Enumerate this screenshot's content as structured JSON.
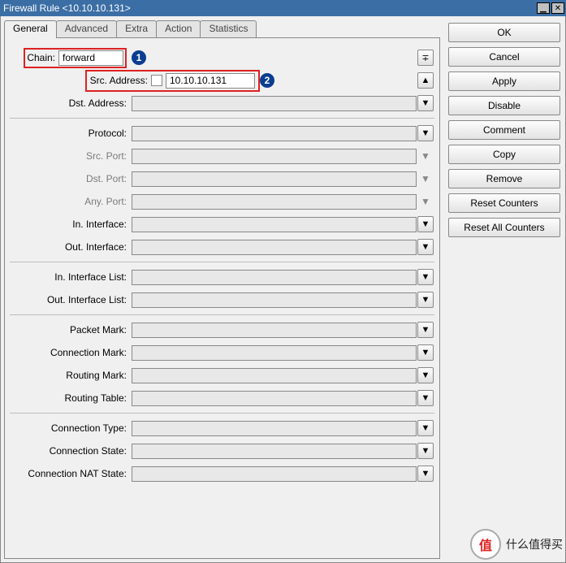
{
  "window": {
    "title": "Firewall Rule <10.10.10.131>"
  },
  "tabs": [
    "General",
    "Advanced",
    "Extra",
    "Action",
    "Statistics"
  ],
  "active_tab": "General",
  "fields": {
    "chain_label": "Chain:",
    "chain_value": "forward",
    "src_addr_label": "Src. Address:",
    "src_addr_value": "10.10.10.131",
    "dst_addr_label": "Dst. Address:",
    "protocol_label": "Protocol:",
    "src_port_label": "Src. Port:",
    "dst_port_label": "Dst. Port:",
    "any_port_label": "Any. Port:",
    "in_if_label": "In. Interface:",
    "out_if_label": "Out. Interface:",
    "in_if_list_label": "In. Interface List:",
    "out_if_list_label": "Out. Interface List:",
    "packet_mark_label": "Packet Mark:",
    "conn_mark_label": "Connection Mark:",
    "routing_mark_label": "Routing Mark:",
    "routing_table_label": "Routing Table:",
    "conn_type_label": "Connection Type:",
    "conn_state_label": "Connection State:",
    "conn_nat_state_label": "Connection NAT State:"
  },
  "annotations": {
    "badge1": "1",
    "badge2": "2"
  },
  "buttons": {
    "ok": "OK",
    "cancel": "Cancel",
    "apply": "Apply",
    "disable": "Disable",
    "comment": "Comment",
    "copy": "Copy",
    "remove": "Remove",
    "reset_counters": "Reset Counters",
    "reset_all_counters": "Reset All Counters"
  },
  "watermark": {
    "logo": "值",
    "text": "什么值得买"
  }
}
